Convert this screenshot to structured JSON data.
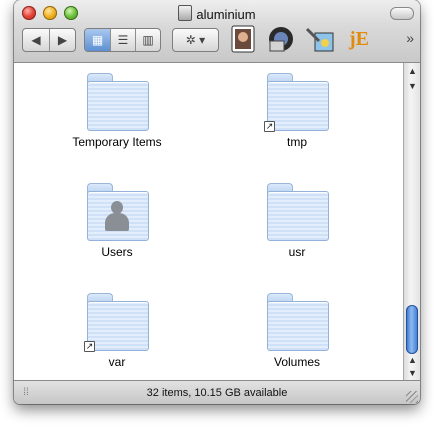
{
  "window": {
    "title": "aluminium",
    "status_text": "32 items, 10.15 GB available"
  },
  "toolbar": {
    "back_label": "◀",
    "forward_label": "▶",
    "view_icon_label": "▦",
    "view_list_label": "☰",
    "view_column_label": "▥",
    "action_label": "✲ ▾",
    "more_label": "»",
    "app_icons": [
      "photo-booth-icon",
      "image-capture-icon",
      "preview-icon",
      "je-editor-icon"
    ]
  },
  "items": [
    {
      "label": "Temporary Items",
      "alias": false,
      "user": false
    },
    {
      "label": "tmp",
      "alias": true,
      "user": false
    },
    {
      "label": "Users",
      "alias": false,
      "user": true
    },
    {
      "label": "usr",
      "alias": false,
      "user": false
    },
    {
      "label": "var",
      "alias": true,
      "user": false
    },
    {
      "label": "Volumes",
      "alias": false,
      "user": false
    }
  ],
  "scrollbar": {
    "up": "▲",
    "down": "▼"
  }
}
